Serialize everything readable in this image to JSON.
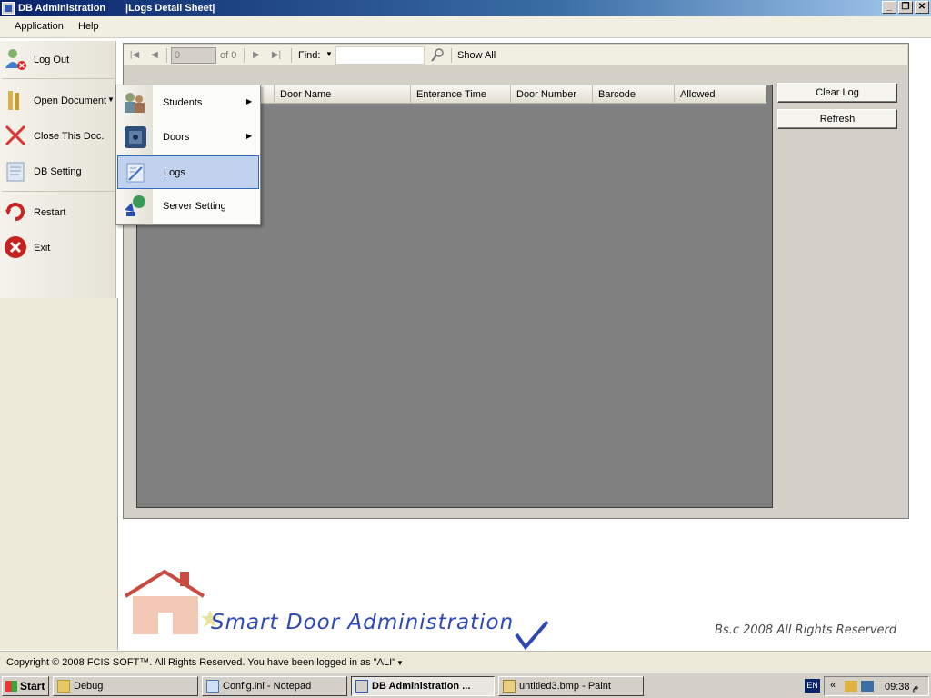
{
  "window": {
    "title": "DB Administration",
    "subtitle": "|Logs Detail Sheet|",
    "controls": [
      "_",
      "❐",
      "✕"
    ]
  },
  "menubar": {
    "items": [
      "Application",
      "Help"
    ]
  },
  "sidebar": {
    "logout": "Log Out",
    "open_document": "Open Document",
    "close_doc": "Close This Doc.",
    "db_setting": "DB Setting",
    "restart": "Restart",
    "exit": "Exit"
  },
  "dropdown": {
    "items": [
      {
        "label": "Students",
        "submenu": true,
        "icon": "students-icon"
      },
      {
        "label": "Doors",
        "submenu": true,
        "icon": "door-icon"
      },
      {
        "label": "Logs",
        "submenu": false,
        "icon": "logs-icon",
        "selected": true
      },
      {
        "label": "Server Setting",
        "submenu": false,
        "icon": "server-icon"
      }
    ]
  },
  "toolbar": {
    "position_value": "0",
    "of_label": "of 0",
    "find_label": "Find:",
    "find_value": "",
    "show_all": "Show All"
  },
  "grid": {
    "columns": [
      "Door Name",
      "Enterance Time",
      "Door Number",
      "Barcode",
      "Allowed"
    ]
  },
  "actions": {
    "clear_log": "Clear Log",
    "refresh": "Refresh"
  },
  "branding": {
    "title": "Smart Door Administration",
    "rights": "Bs.c 2008  All Rights Reserverd"
  },
  "status": {
    "text": "Copyright © 2008 FCIS SOFT™. All Rights Reserved.   You have been logged in as \"ALI\""
  },
  "taskbar": {
    "start": "Start",
    "tasks": [
      "Debug",
      "Config.ini - Notepad",
      "DB Administration     ...",
      "untitled3.bmp - Paint"
    ],
    "lang": "EN",
    "clock": "09:38 م"
  }
}
